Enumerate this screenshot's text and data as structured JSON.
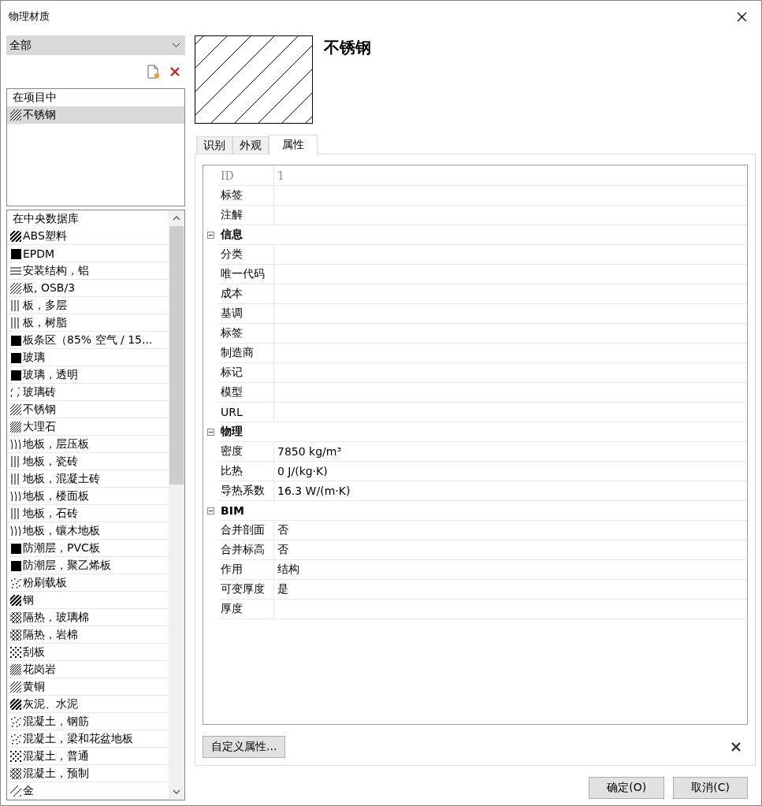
{
  "window": {
    "title": "物理材质"
  },
  "filter": {
    "value": "全部"
  },
  "project_list": {
    "heading": "在项目中",
    "items": [
      {
        "name": "不锈钢",
        "kind": "diag",
        "selected": true
      }
    ]
  },
  "library_list": {
    "heading": "在中央数据库",
    "items": [
      {
        "name": "ABS塑料",
        "kind": "diag-bold",
        "selected": false
      },
      {
        "name": "EPDM",
        "kind": "solid",
        "selected": false
      },
      {
        "name": "安装结构，铝",
        "kind": "horizontal",
        "selected": false
      },
      {
        "name": "板, OSB/3",
        "kind": "diag",
        "selected": false
      },
      {
        "name": "板，多层",
        "kind": "vertical",
        "selected": false
      },
      {
        "name": "板，树脂",
        "kind": "vertical",
        "selected": false
      },
      {
        "name": "板条区（85% 空气 / 15...",
        "kind": "solid",
        "selected": false
      },
      {
        "name": "玻璃",
        "kind": "solid",
        "selected": false
      },
      {
        "name": "玻璃，透明",
        "kind": "solid",
        "selected": false
      },
      {
        "name": "玻璃砖",
        "kind": "corners",
        "selected": false
      },
      {
        "name": "不锈钢",
        "kind": "diag",
        "selected": false
      },
      {
        "name": "大理石",
        "kind": "dense",
        "selected": false
      },
      {
        "name": "地板，层压板",
        "kind": "wave",
        "selected": false
      },
      {
        "name": "地板，瓷砖",
        "kind": "vertical",
        "selected": false
      },
      {
        "name": "地板，混凝土砖",
        "kind": "vertical",
        "selected": false
      },
      {
        "name": "地板，楼面板",
        "kind": "wave",
        "selected": false
      },
      {
        "name": "地板，石砖",
        "kind": "vertical",
        "selected": false
      },
      {
        "name": "地板，镶木地板",
        "kind": "wave",
        "selected": false
      },
      {
        "name": "防潮层，PVC板",
        "kind": "solid",
        "selected": false
      },
      {
        "name": "防潮层，聚乙烯板",
        "kind": "solid",
        "selected": false
      },
      {
        "name": "粉刷载板",
        "kind": "dots",
        "selected": false
      },
      {
        "name": "钢",
        "kind": "diag-bold",
        "selected": false
      },
      {
        "name": "隔热，玻璃棉",
        "kind": "cross",
        "selected": false
      },
      {
        "name": "隔热，岩棉",
        "kind": "cross",
        "selected": false
      },
      {
        "name": "刮板",
        "kind": "checker",
        "selected": false
      },
      {
        "name": "花岗岩",
        "kind": "dense",
        "selected": false
      },
      {
        "name": "黄铜",
        "kind": "diag",
        "selected": false
      },
      {
        "name": "灰泥、水泥",
        "kind": "diag-bold",
        "selected": false
      },
      {
        "name": "混凝土，钢筋",
        "kind": "dots",
        "selected": false
      },
      {
        "name": "混凝土，梁和花盆地板",
        "kind": "dots",
        "selected": false
      },
      {
        "name": "混凝土，普通",
        "kind": "checker",
        "selected": false
      },
      {
        "name": "混凝土，预制",
        "kind": "cross",
        "selected": false
      },
      {
        "name": "金",
        "kind": "diag-sparse",
        "selected": false
      }
    ]
  },
  "material": {
    "name": "不锈钢",
    "kind": "diag"
  },
  "tabs": [
    {
      "label": "识别",
      "selected": false
    },
    {
      "label": "外观",
      "selected": false
    },
    {
      "label": "属性",
      "selected": true
    }
  ],
  "properties": [
    {
      "kind": "field",
      "label": "ID",
      "value": "1",
      "disabled": true
    },
    {
      "kind": "field",
      "label": "标签",
      "disabled": false
    },
    {
      "kind": "field",
      "label": "注解",
      "disabled": false
    },
    {
      "kind": "group",
      "label": "信息",
      "expanded": true,
      "children": [
        {
          "kind": "field",
          "label": "分类",
          "disabled": false
        },
        {
          "kind": "field",
          "label": "唯一代码",
          "disabled": false
        },
        {
          "kind": "field",
          "label": "成本",
          "disabled": false
        },
        {
          "kind": "field",
          "label": "基调",
          "disabled": false
        },
        {
          "kind": "field",
          "label": "标签",
          "disabled": false
        },
        {
          "kind": "field",
          "label": "制造商",
          "disabled": false
        },
        {
          "kind": "field",
          "label": "标记",
          "disabled": false
        },
        {
          "kind": "field",
          "label": "模型",
          "disabled": false
        },
        {
          "kind": "field",
          "label": "URL",
          "disabled": false
        }
      ]
    },
    {
      "kind": "group",
      "label": "物理",
      "expanded": true,
      "children": [
        {
          "kind": "field",
          "label": "密度",
          "value": "7850 kg/m³",
          "disabled": false
        },
        {
          "kind": "field",
          "label": "比热",
          "value": "0 J/(kg·K)",
          "disabled": false
        },
        {
          "kind": "field",
          "label": "导热系数",
          "value": "16.3 W/(m·K)",
          "disabled": false
        }
      ]
    },
    {
      "kind": "group",
      "label": "BIM",
      "expanded": true,
      "children": [
        {
          "kind": "field",
          "label": "合并剖面",
          "value": "否",
          "disabled": false
        },
        {
          "kind": "field",
          "label": "合并标高",
          "value": "否",
          "disabled": false
        },
        {
          "kind": "field",
          "label": "作用",
          "value": "结构",
          "disabled": false
        },
        {
          "kind": "field",
          "label": "可变厚度",
          "value": "是",
          "disabled": false
        },
        {
          "kind": "field",
          "label": "厚度",
          "disabled": false
        }
      ]
    }
  ],
  "custom_button": "自定义属性...",
  "buttons": [
    "确定(O)",
    "取消(C)"
  ]
}
